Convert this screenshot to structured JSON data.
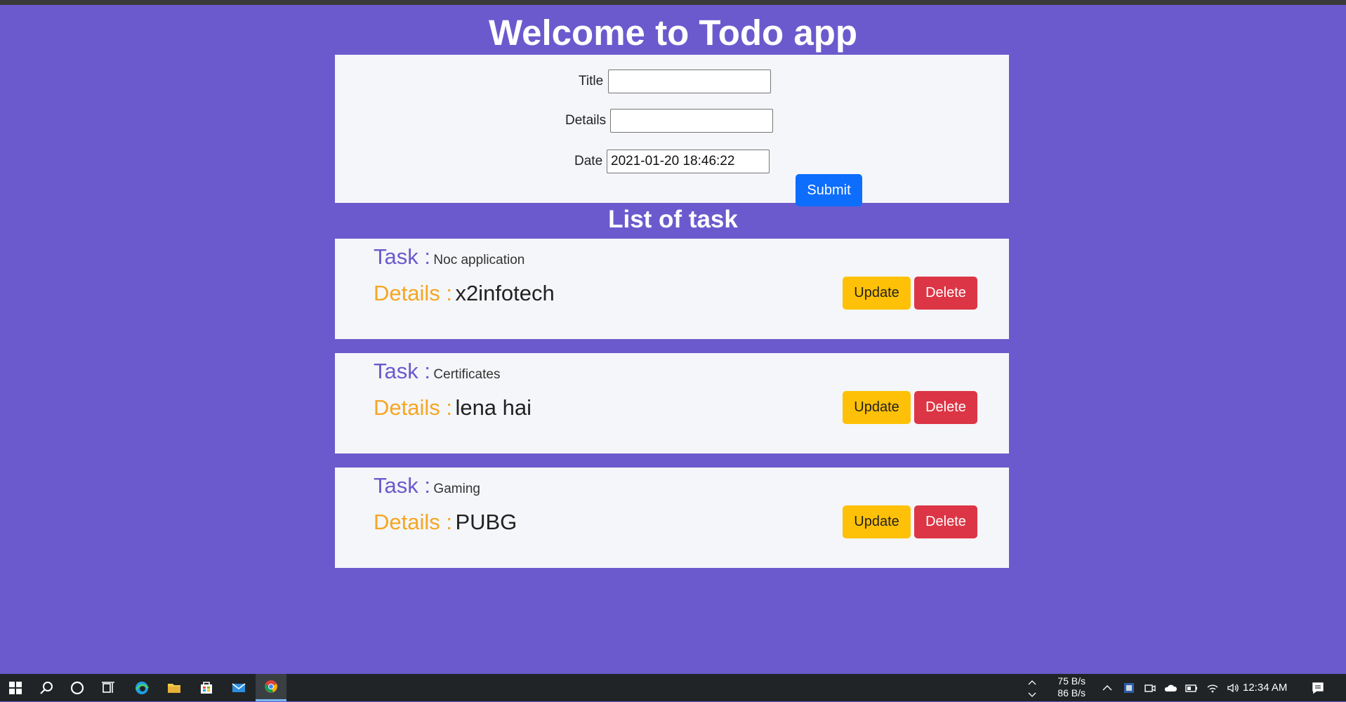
{
  "header": {
    "title": "Welcome to Todo app"
  },
  "form": {
    "title_label": "Title",
    "title_value": "",
    "details_label": "Details",
    "details_value": "",
    "date_label": "Date",
    "date_value": "2021-01-20 18:46:22",
    "submit_label": "Submit"
  },
  "list": {
    "heading": "List of task",
    "task_key": "Task :",
    "details_key": "Details :",
    "update_label": "Update",
    "delete_label": "Delete",
    "items": [
      {
        "task": "Noc application",
        "details": "x2infotech"
      },
      {
        "task": "Certificates",
        "details": "lena hai"
      },
      {
        "task": "Gaming",
        "details": "PUBG"
      }
    ]
  },
  "taskbar": {
    "icons": [
      "windows-start-icon",
      "search-icon",
      "cortana-icon",
      "task-view-icon",
      "edge-icon",
      "file-explorer-icon",
      "store-icon",
      "mail-icon",
      "chrome-icon"
    ],
    "net_up": "75 B/s",
    "net_down": "86 B/s",
    "clock": "12:34 AM"
  },
  "colors": {
    "background": "#6b5acd",
    "card": "#f4f6f9",
    "submit": "#0d6efd",
    "update": "#ffc107",
    "delete": "#dc3545",
    "task_key": "#6b5acd",
    "details_key": "#f5a623"
  }
}
